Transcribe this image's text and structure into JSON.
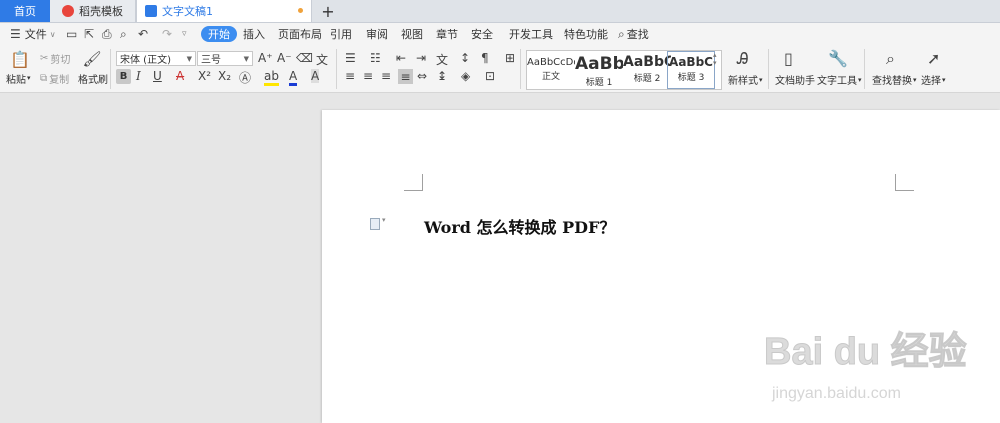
{
  "tabs": {
    "home": "首页",
    "template": "稻壳模板",
    "document": "文字文稿1",
    "new_tab": "+"
  },
  "menu": {
    "file": "文件",
    "items": [
      "开始",
      "插入",
      "页面布局",
      "引用",
      "审阅",
      "视图",
      "章节",
      "安全",
      "开发工具",
      "特色功能"
    ],
    "search": "查找"
  },
  "toolbar": {
    "paste": "粘贴",
    "cut": "剪切",
    "copy": "复制",
    "format_painter": "格式刷",
    "font_name": "宋体 (正文)",
    "font_size": "三号",
    "styles": [
      {
        "preview": "AaBbCcDd",
        "label": "正文"
      },
      {
        "preview": "AaBb",
        "label": "标题 1"
      },
      {
        "preview": "AaBbC",
        "label": "标题 2"
      },
      {
        "preview": "AaBbC",
        "label": "标题 3"
      }
    ],
    "new_style": "新样式",
    "doc_assistant": "文档助手",
    "text_tools": "文字工具",
    "find_replace": "查找替换",
    "select": "选择"
  },
  "document": {
    "heading": "Word 怎么转换成 PDF？"
  },
  "watermark": {
    "brand": "Bai du 经验",
    "url": "jingyan.baidu.com"
  },
  "colors": {
    "accent": "#2f7be6",
    "active_tab": "#3c8df0"
  }
}
